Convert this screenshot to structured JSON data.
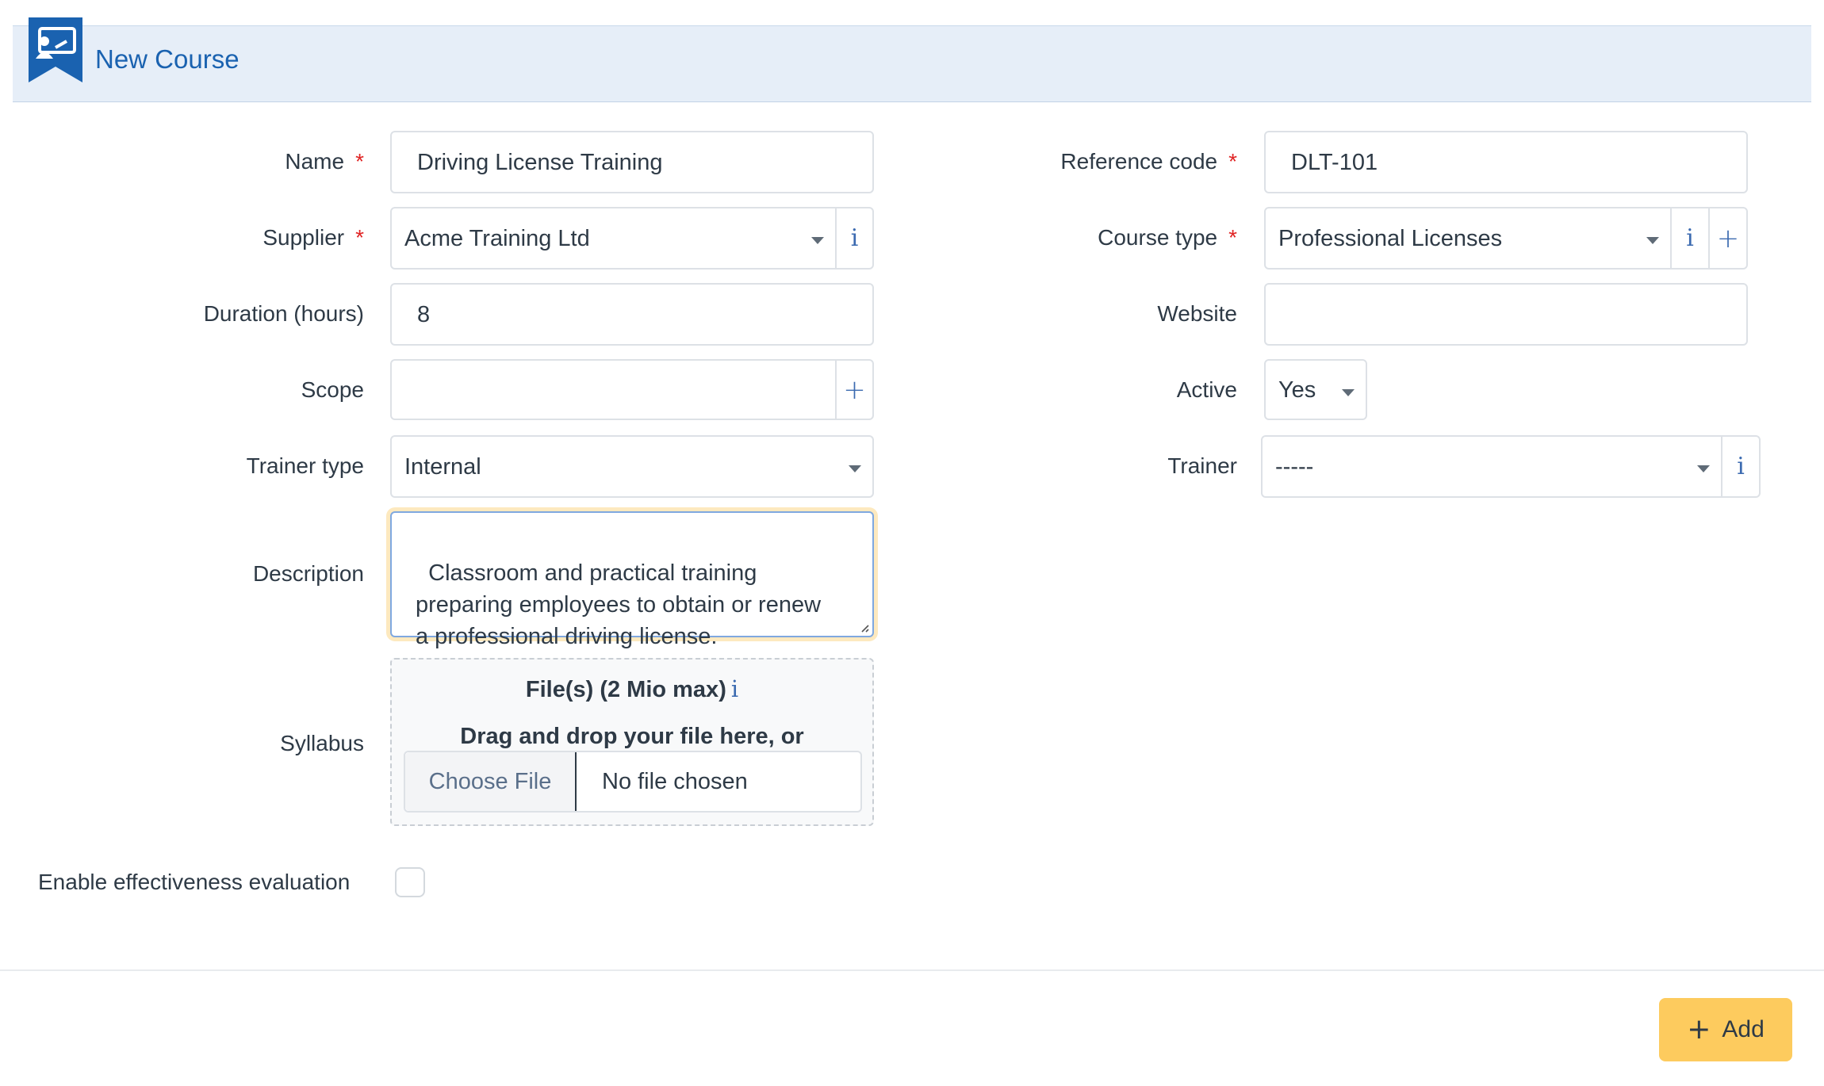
{
  "header": {
    "title": "New Course",
    "icon": "course-presentation-icon",
    "accent": "#1a62b0"
  },
  "form": {
    "name": {
      "label": "Name",
      "required_mark": "*",
      "value": "Driving License Training"
    },
    "reference_code": {
      "label": "Reference code",
      "required_mark": "*",
      "value": "DLT-101"
    },
    "supplier": {
      "label": "Supplier",
      "required_mark": "*",
      "value": "Acme Training Ltd",
      "info": "i"
    },
    "course_type": {
      "label": "Course type",
      "required_mark": "*",
      "value": "Professional Licenses",
      "info": "i",
      "add": "+"
    },
    "duration": {
      "label": "Duration (hours)",
      "value": "8"
    },
    "website": {
      "label": "Website",
      "value": ""
    },
    "scope": {
      "label": "Scope",
      "value": "",
      "add": "+"
    },
    "active": {
      "label": "Active",
      "value": "Yes"
    },
    "trainer_type": {
      "label": "Trainer type",
      "value": "Internal"
    },
    "trainer": {
      "label": "Trainer",
      "value": "-----",
      "info": "i"
    },
    "description": {
      "label": "Description",
      "value": "Classroom and practical training\npreparing employees to obtain or renew\na professional driving license."
    },
    "syllabus": {
      "label": "Syllabus",
      "title": "File(s) (2 Mio max)",
      "info": "i",
      "subtitle": "Drag and drop your file here, or",
      "choose_button": "Choose File",
      "file_status": "No file chosen"
    },
    "effectiveness": {
      "label": "Enable effectiveness evaluation",
      "checked": false
    }
  },
  "footer": {
    "add_label": "Add",
    "add_icon": "+",
    "add_color": "#fdcb5e"
  },
  "colors": {
    "required": "#e02424",
    "header_bg": "#e6eef8",
    "focus_ring": "#fde9bf"
  }
}
